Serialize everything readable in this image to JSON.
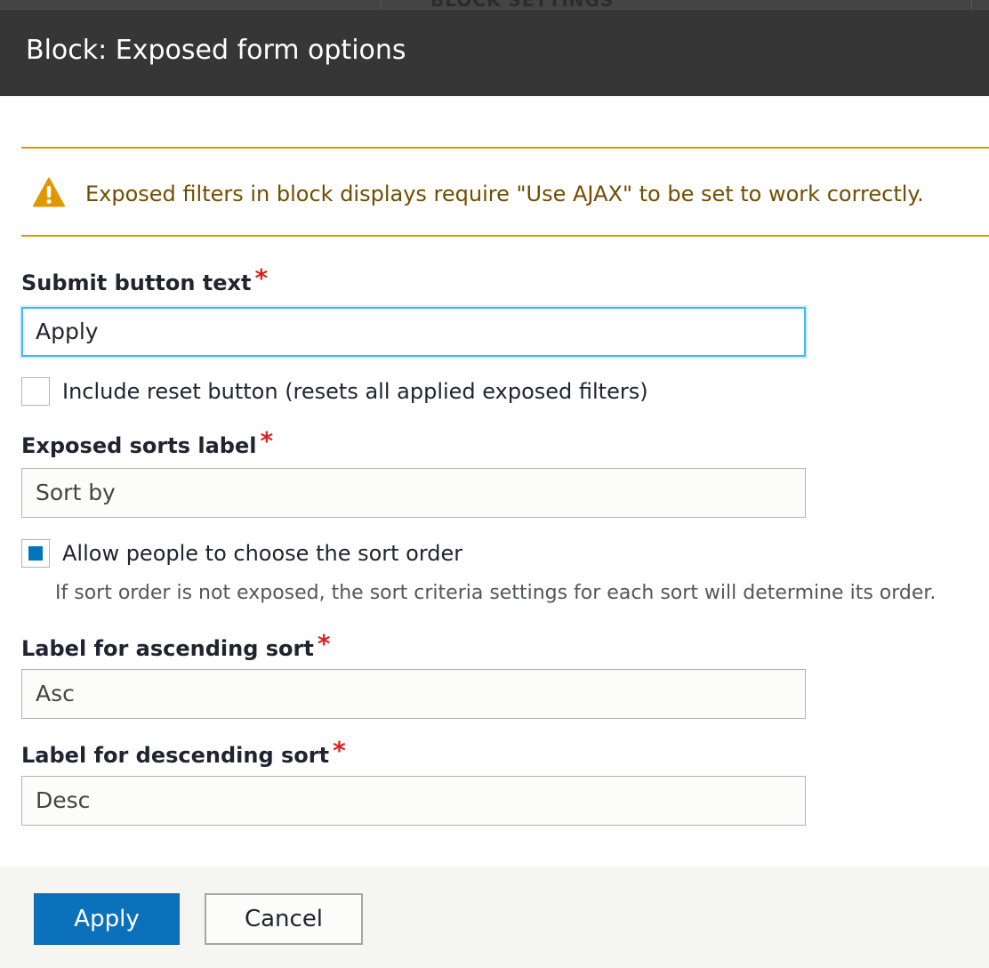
{
  "background_page": {
    "tab_label": "BLOCK SETTINGS"
  },
  "dialog": {
    "title": "Block: Exposed form options"
  },
  "warning": {
    "message": "Exposed filters in block displays require \"Use AJAX\" to be set to work correctly.",
    "icon": "warning-icon",
    "color": "#e09600"
  },
  "form": {
    "submit_button_text": {
      "label": "Submit button text",
      "required_marker": "*",
      "value": "Apply"
    },
    "include_reset": {
      "label": "Include reset button (resets all applied exposed filters)",
      "checked": false
    },
    "exposed_sorts_label": {
      "label": "Exposed sorts label",
      "required_marker": "*",
      "value": "Sort by"
    },
    "allow_sort_order": {
      "label": "Allow people to choose the sort order",
      "checked": true,
      "description": "If sort order is not exposed, the sort criteria settings for each sort will determine its order."
    },
    "ascending_label": {
      "label": "Label for ascending sort",
      "required_marker": "*",
      "value": "Asc"
    },
    "descending_label": {
      "label": "Label for descending sort",
      "required_marker": "*",
      "value": "Desc"
    }
  },
  "buttons": {
    "apply_label": "Apply",
    "cancel_label": "Cancel"
  },
  "colors": {
    "primary": "#0c71bb",
    "required": "#dc2323",
    "focus": "#40b6ff",
    "titlebar": "#363636"
  }
}
